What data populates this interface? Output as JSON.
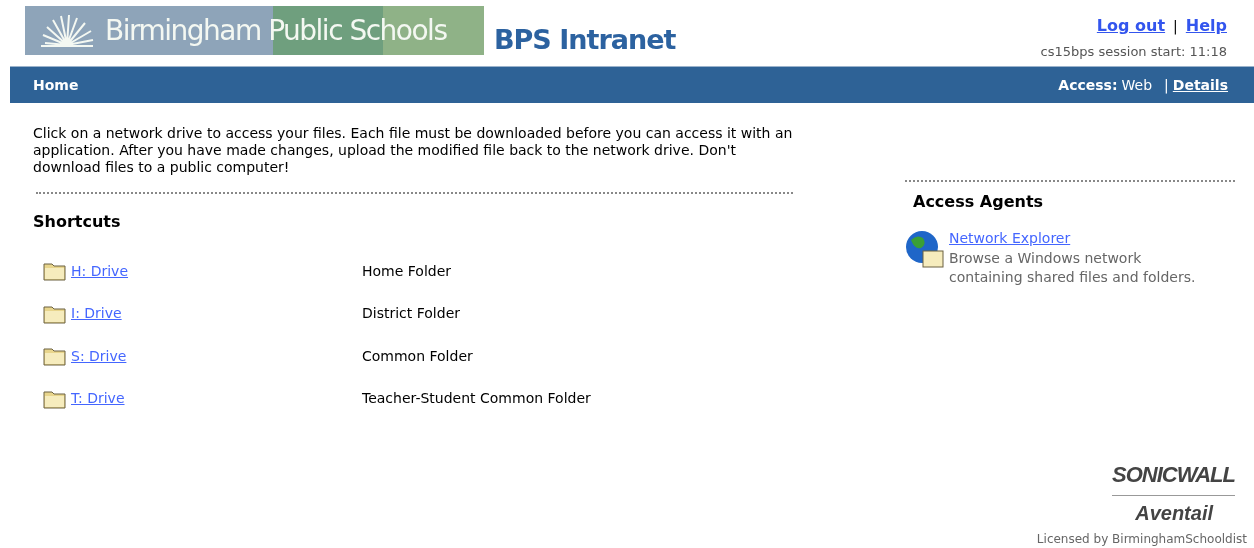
{
  "header": {
    "banner_title": "Birmingham Public Schools",
    "site_title": "BPS Intranet",
    "links": [
      "Log out",
      "Help"
    ],
    "separator": "|",
    "session": "cs15bps session start: 11:18"
  },
  "navbar": {
    "title": "Home",
    "access_label": "Access:",
    "access_value": "Web",
    "separator": "|",
    "details_link": "Details"
  },
  "intro": "Click on a network drive to access your files. Each file must be downloaded before you can access it with an application. After you have made changes, upload the modified file back to the network drive. Don't download files to a public computer!",
  "shortcuts": {
    "heading": "Shortcuts",
    "items": [
      {
        "drive": "H: Drive",
        "description": "Home Folder"
      },
      {
        "drive": "I: Drive",
        "description": "District Folder"
      },
      {
        "drive": "S: Drive",
        "description": "Common Folder"
      },
      {
        "drive": "T: Drive",
        "description": "Teacher-Student Common Folder"
      }
    ]
  },
  "access_agents": {
    "heading": "Access Agents",
    "items": [
      {
        "name": "Network Explorer",
        "description": "Browse a Windows network containing shared files and folders."
      }
    ]
  },
  "footer": {
    "logo_top": "SONICWALL",
    "logo_bottom": "Aventail",
    "license": "Licensed by BirminghamSchooldist"
  }
}
